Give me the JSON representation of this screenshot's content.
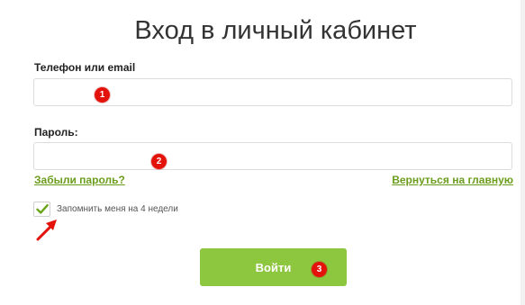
{
  "header": {
    "title": "Вход в личный кабинет"
  },
  "form": {
    "phone_label": "Телефон или email",
    "phone_value": "",
    "password_label": "Пароль:",
    "password_value": "",
    "forgot_link": "Забыли пароль?",
    "home_link": "Вернуться на главную",
    "remember_label": "Запомнить меня на 4 недели",
    "remember_checked": true,
    "submit_label": "Войти"
  },
  "markers": {
    "m1": "1",
    "m2": "2",
    "m3": "3"
  },
  "colors": {
    "accent_green": "#8dc63f",
    "link_green": "#6b9d1c",
    "marker_red": "#e3120b"
  },
  "icons": {
    "checkmark": "check-icon",
    "annotation_arrow": "arrow-icon"
  }
}
